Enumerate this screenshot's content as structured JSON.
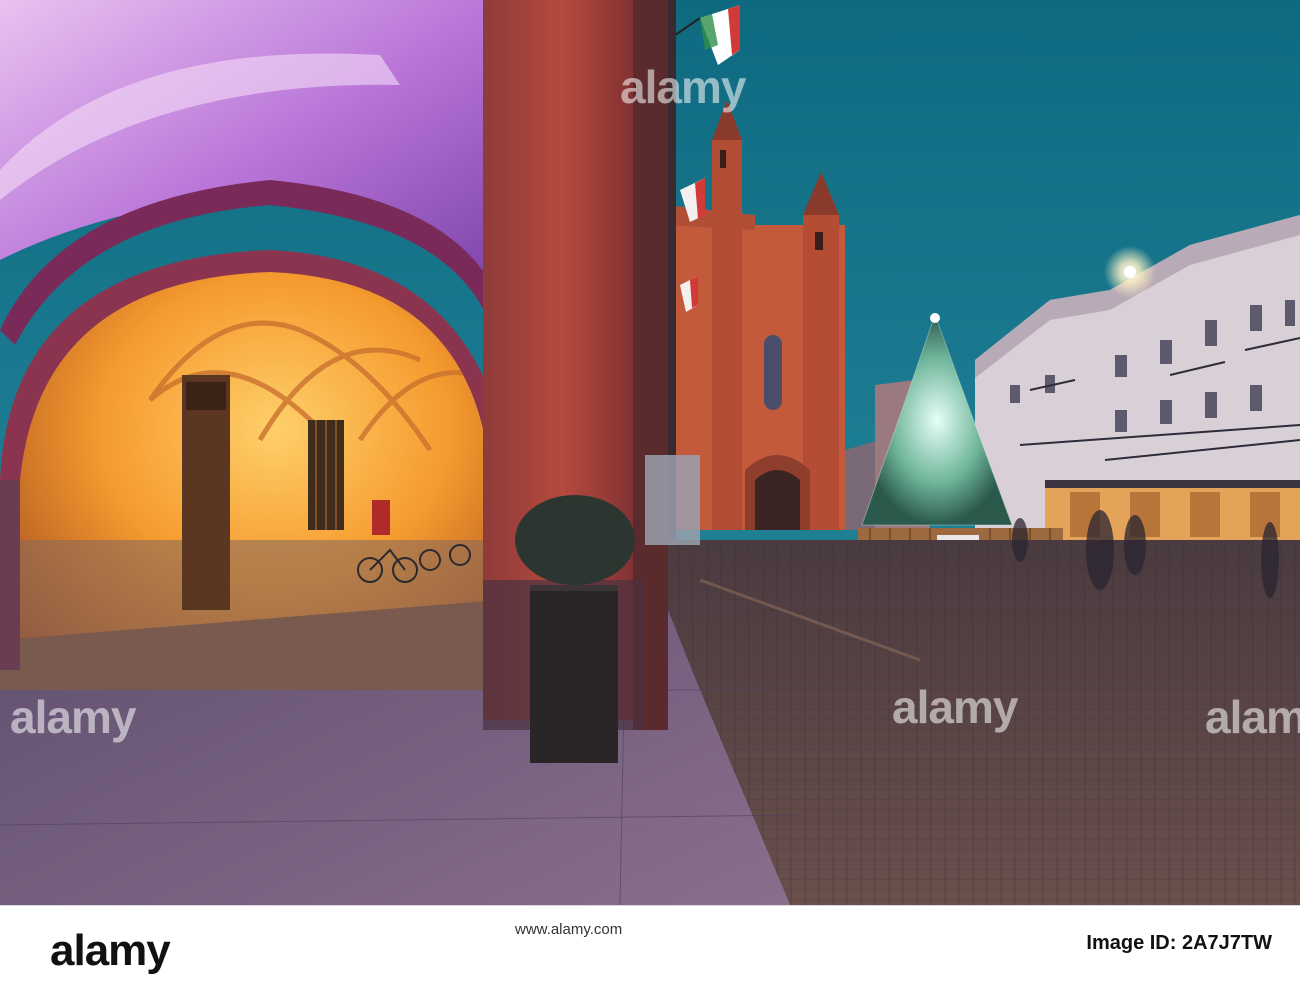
{
  "watermark": {
    "text": "alamy",
    "color": "#ffffff"
  },
  "footer": {
    "logo": "alamy",
    "image_id_label": "Image ID: 2A7J7TW",
    "url": "www.alamy.com"
  },
  "scene": {
    "sky_color": "#1f7a8c",
    "arcade_glow": "#f59a2e",
    "brick_color": "#b5452c"
  }
}
